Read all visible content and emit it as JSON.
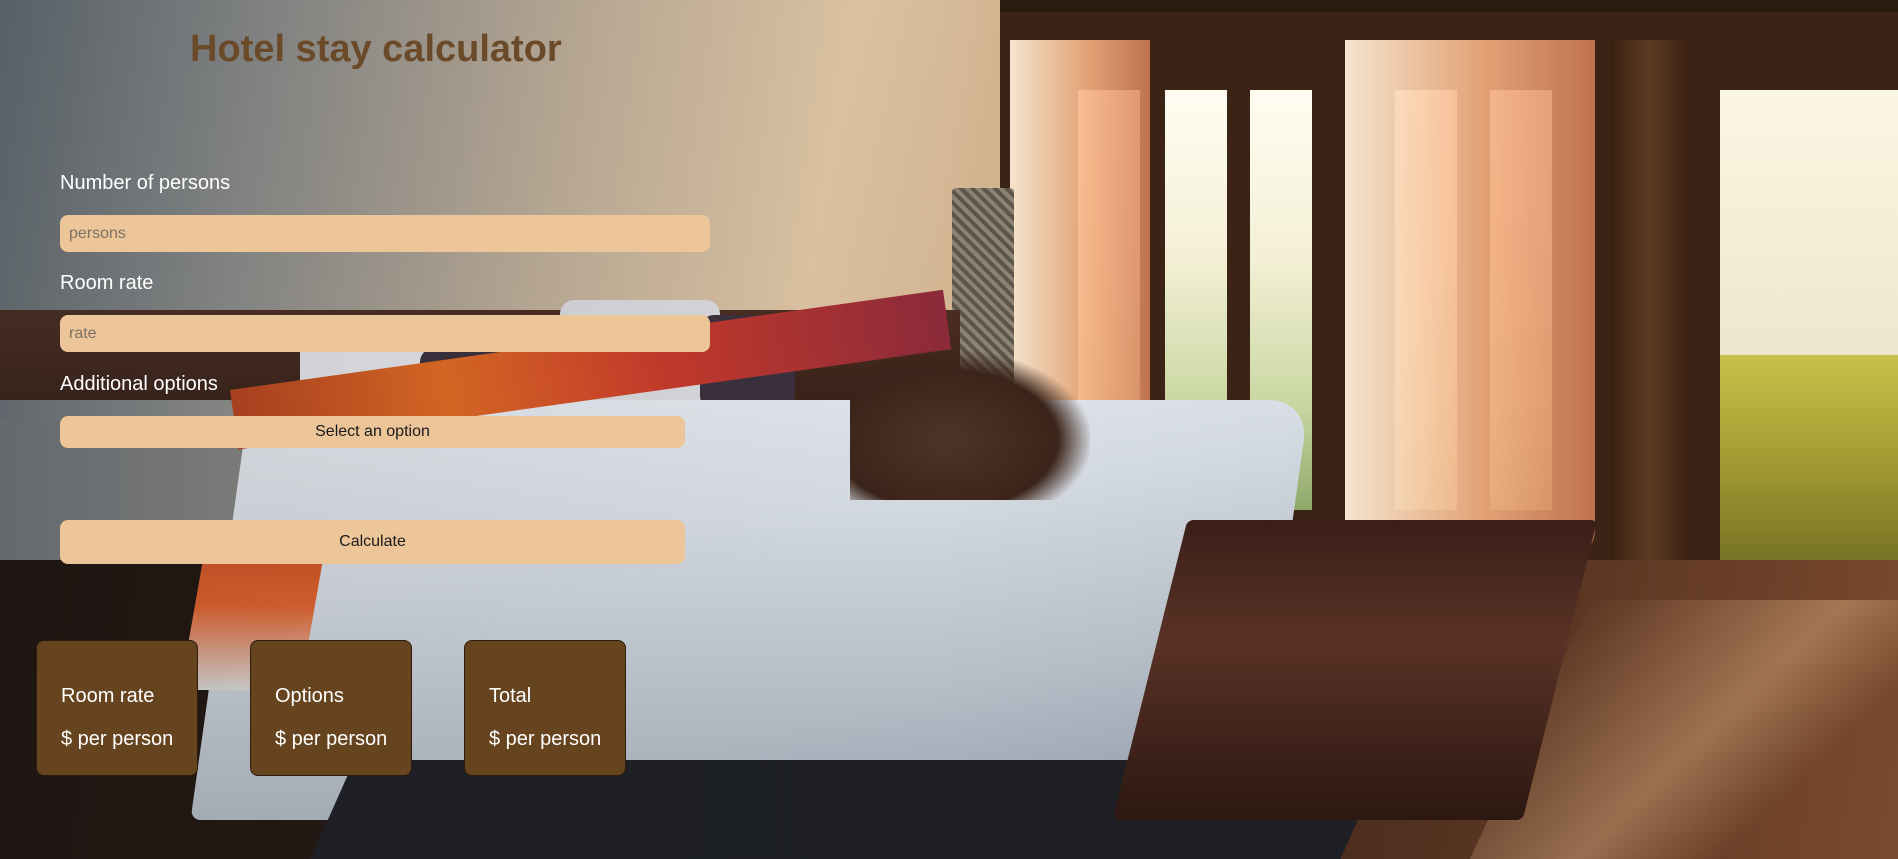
{
  "page": {
    "title": "Hotel stay calculator"
  },
  "form": {
    "persons": {
      "label": "Number of persons",
      "placeholder": "persons",
      "value": ""
    },
    "rate": {
      "label": "Room rate",
      "placeholder": "rate",
      "value": ""
    },
    "options": {
      "label": "Additional options",
      "selected": "Select an option"
    },
    "calculate_label": "Calculate"
  },
  "results": [
    {
      "title": "Room rate",
      "value": "$ per person"
    },
    {
      "title": "Options",
      "value": "$ per person"
    },
    {
      "title": "Total",
      "value": "$ per person"
    }
  ],
  "colors": {
    "accent": "#ecc699",
    "card_background": "#66441f",
    "title_color": "#6b4a2a",
    "label_color": "#ffffff"
  }
}
